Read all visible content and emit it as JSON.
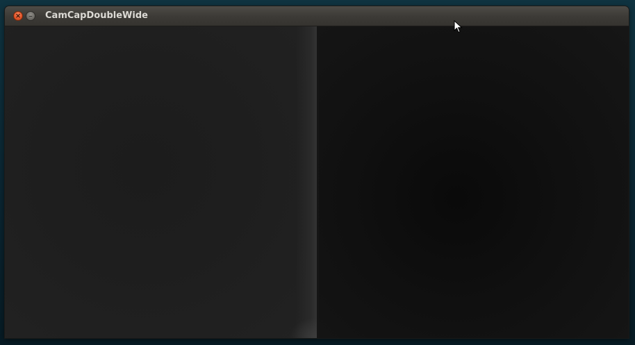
{
  "window": {
    "title": "CamCapDoubleWide",
    "controls": {
      "close_icon": "close-icon",
      "minimize_icon": "minimize-icon"
    }
  },
  "content": {
    "panes": [
      "left-camera-feed",
      "right-camera-feed"
    ]
  },
  "colors": {
    "close_button": "#e5562a",
    "titlebar": "#3d3b37",
    "title_text": "#dcdad5"
  }
}
